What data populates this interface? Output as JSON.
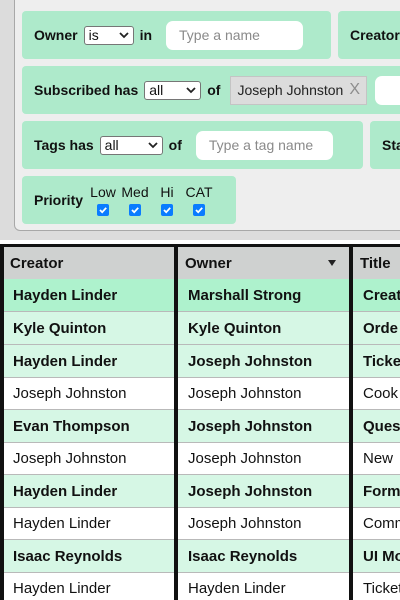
{
  "filters": {
    "owner": {
      "label": "Owner",
      "operator": "is",
      "connector": "in",
      "placeholder": "Type a name"
    },
    "creator": {
      "label": "Creator"
    },
    "subscribed": {
      "label": "Subscribed has",
      "operator": "all",
      "connector": "of",
      "chip": "Joseph Johnston",
      "chip_remove": "X"
    },
    "tags": {
      "label": "Tags has",
      "operator": "all",
      "connector": "of",
      "placeholder": "Type a tag name"
    },
    "status": {
      "label": "Sta"
    },
    "priority": {
      "label": "Priority",
      "options": [
        {
          "label": "Low",
          "checked": true
        },
        {
          "label": "Med",
          "checked": true
        },
        {
          "label": "Hi",
          "checked": true
        },
        {
          "label": "CAT",
          "checked": true
        }
      ]
    }
  },
  "table": {
    "columns": {
      "creator": "Creator",
      "owner": "Owner",
      "title": "Title"
    },
    "rows": [
      {
        "creator": "Hayden Linder",
        "owner": "Marshall Strong",
        "title": "Creat",
        "style": "bold",
        "bg": "#aef2cd"
      },
      {
        "creator": "Kyle Quinton",
        "owner": "Kyle Quinton",
        "title": "Orde",
        "style": "bold",
        "bg": "#d6f7e5"
      },
      {
        "creator": "Hayden Linder",
        "owner": "Joseph Johnston",
        "title": "Ticke",
        "style": "bold",
        "bg": "#d6f7e5"
      },
      {
        "creator": "Joseph Johnston",
        "owner": "Joseph Johnston",
        "title": "Cook l",
        "style": "normal",
        "bg": "#ffffff"
      },
      {
        "creator": "Evan Thompson",
        "owner": "Joseph Johnston",
        "title": "Ques",
        "style": "bold",
        "bg": "#d6f7e5"
      },
      {
        "creator": "Joseph Johnston",
        "owner": "Joseph Johnston",
        "title": "New",
        "style": "normal",
        "bg": "#ffffff"
      },
      {
        "creator": "Hayden Linder",
        "owner": "Joseph Johnston",
        "title": "Form",
        "style": "bold",
        "bg": "#d6f7e5"
      },
      {
        "creator": "Hayden Linder",
        "owner": "Joseph Johnston",
        "title": "Comm",
        "style": "normal",
        "bg": "#ffffff"
      },
      {
        "creator": "Isaac Reynolds",
        "owner": "Isaac Reynolds",
        "title": "UI Mo",
        "style": "bold",
        "bg": "#d6f7e5"
      },
      {
        "creator": "Hayden Linder",
        "owner": "Hayden Linder",
        "title": "Ticket",
        "style": "normal",
        "bg": "#ffffff"
      }
    ]
  },
  "icons": {
    "dropdown": "chevron-down-icon",
    "sort": "sort-down-icon",
    "checkbox": "check-icon"
  },
  "colors": {
    "filter_pill": "#aeeacb",
    "highlight_row": "#aef2cd",
    "bold_row": "#d6f7e5",
    "checkbox": "#0a7cff"
  }
}
